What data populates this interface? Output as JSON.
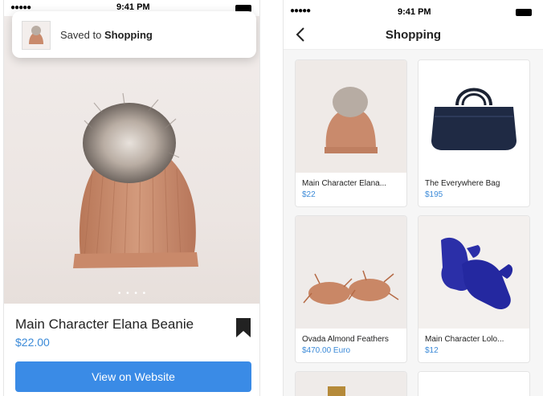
{
  "left_screen": {
    "status_bar": {
      "time": "9:41 PM"
    },
    "toast": {
      "text_prefix": "Saved to ",
      "collection": "Shopping"
    },
    "product": {
      "title": "Main Character Elana Beanie",
      "price": "$22.00",
      "image_icon": "beanie-image"
    },
    "carousel": {
      "dots": "• • • •"
    },
    "cta_label": "View on Website",
    "bookmark_icon": "bookmark-icon"
  },
  "right_screen": {
    "status_bar": {
      "time": "9:41 PM"
    },
    "nav": {
      "title": "Shopping",
      "back_icon": "chevron-left-icon"
    },
    "items": [
      {
        "name": "Main Character Elana...",
        "price": "$22",
        "image": "beanie-image"
      },
      {
        "name": "The Everywhere Bag",
        "price": "$195",
        "image": "duffel-bag-image"
      },
      {
        "name": "Ovada Almond Feathers",
        "price": "$470.00 Euro",
        "image": "feather-slippers-image"
      },
      {
        "name": "Main Character Lolo...",
        "price": "$12",
        "image": "mittens-image"
      }
    ]
  },
  "colors": {
    "accent": "#3a8be6",
    "price": "#3b8ad8",
    "beanie": "#c98a6c"
  }
}
